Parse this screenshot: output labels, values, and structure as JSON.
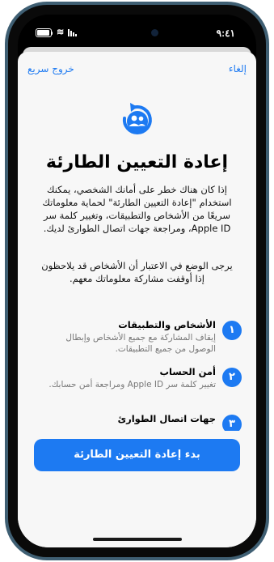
{
  "status_bar": {
    "time": "٩:٤١"
  },
  "nav": {
    "cancel_label": "إلغاء",
    "quick_exit_label": "خروج سريع"
  },
  "hero": {
    "title": "إعادة التعيين الطارئة",
    "paragraph1": "إذا كان هناك خطر على أمانك الشخصي، يمكنك استخدام \"إعادة التعيين الطارئة\" لحماية معلوماتك سريعًا من الأشخاص والتطبيقات، وتغيير كلمة سر Apple ID، ومراجعة جهات اتصال الطوارئ لديك.",
    "paragraph2": "يرجى الوضع في الاعتبار أن الأشخاص قد يلاحظون إذا أوقفت مشاركة معلوماتك معهم."
  },
  "steps": [
    {
      "number": "١",
      "title": "الأشخاص والتطبيقات",
      "desc": "إيقاف المشاركة مع جميع الأشخاص وإبطال الوصول من جميع التطبيقات."
    },
    {
      "number": "٢",
      "title": "أمن الحساب",
      "desc": "تغيير كلمة سر Apple ID ومراجعة أمن حسابك."
    },
    {
      "number": "٣",
      "title": "جهات اتصال الطوارئ",
      "desc": ""
    }
  ],
  "cta": {
    "label": "بدء إعادة التعيين الطارئة"
  },
  "colors": {
    "accent": "#1d7af2",
    "device_frame": "#3f5f73"
  },
  "icons": {
    "hero": "two-people-with-reset-arrow-icon"
  }
}
